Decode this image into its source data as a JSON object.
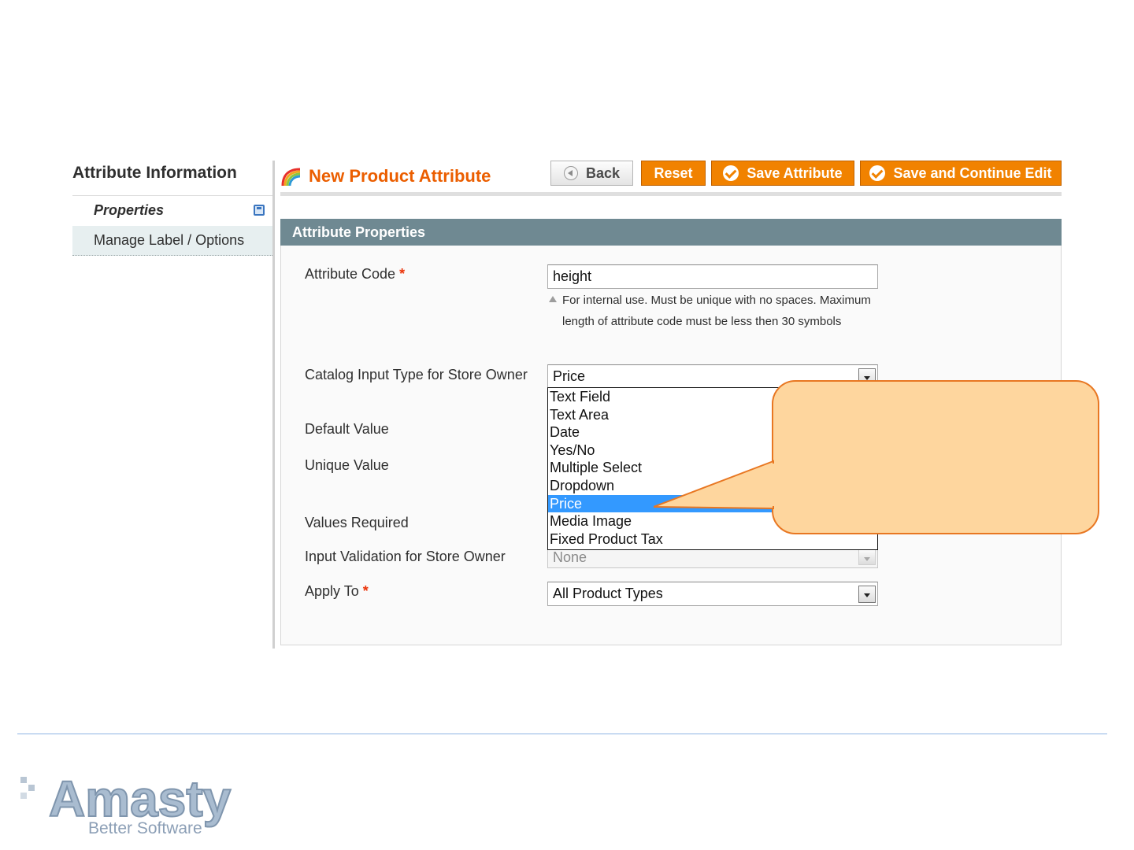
{
  "sidebar": {
    "title": "Attribute Information",
    "tabs": [
      {
        "label": "Properties"
      },
      {
        "label": "Manage Label / Options"
      }
    ]
  },
  "header": {
    "title": "New Product Attribute",
    "buttons": {
      "back": "Back",
      "reset": "Reset",
      "save": "Save Attribute",
      "save_continue": "Save and Continue Edit"
    }
  },
  "section": {
    "title": "Attribute Properties"
  },
  "form": {
    "attribute_code_label": "Attribute Code",
    "required_marker": "*",
    "attribute_code_value": "height",
    "attribute_code_note": "For internal use. Must be unique with no spaces. Maximum length of attribute code must be less then 30 symbols",
    "catalog_input_type_label": "Catalog Input Type for Store Owner",
    "catalog_input_type_value": "Price",
    "default_value_label": "Default Value",
    "unique_value_label": "Unique Value",
    "values_required_label": "Values Required",
    "input_validation_label": "Input Validation for Store Owner",
    "input_validation_value": "None",
    "apply_to_label": "Apply To",
    "apply_to_value": "All Product Types"
  },
  "dropdown": {
    "options": [
      "Text Field",
      "Text Area",
      "Date",
      "Yes/No",
      "Multiple Select",
      "Dropdown",
      "Price",
      "Media Image",
      "Fixed Product Tax"
    ],
    "selected": "Price"
  },
  "footer": {
    "logo": "Amasty",
    "tagline": "Better Software"
  },
  "colors": {
    "accent": "#f18200",
    "title": "#eb5e00",
    "section_header": "#6f8992",
    "selection": "#3399ff",
    "callout_fill": "#fed69e",
    "callout_border": "#e87722"
  }
}
